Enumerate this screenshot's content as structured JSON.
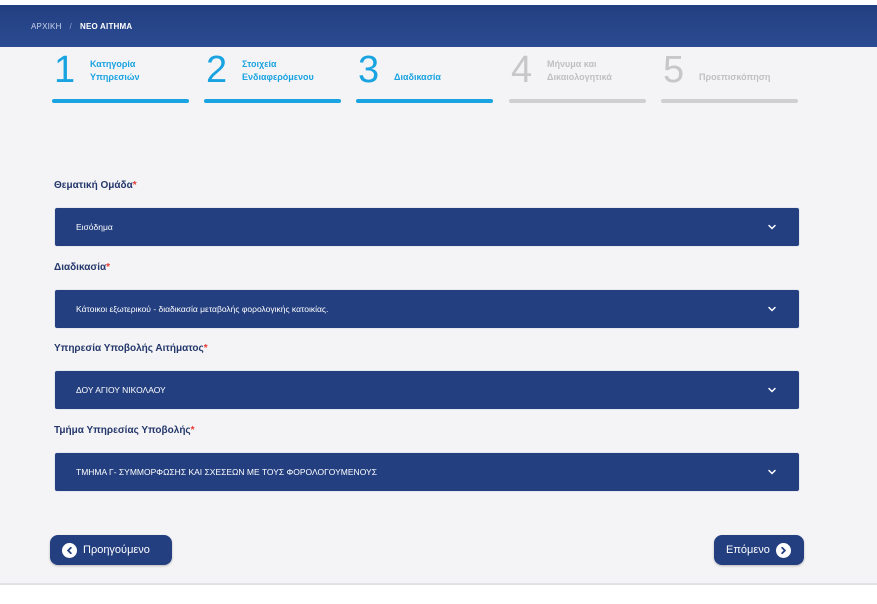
{
  "breadcrumb": {
    "home": "ΑΡΧΙΚΗ",
    "current": "ΝΕΟ ΑΙΤΗΜΑ"
  },
  "steps": [
    {
      "number": "1",
      "line1": "Κατηγορία",
      "line2": "Υπηρεσιών",
      "status": "active"
    },
    {
      "number": "2",
      "line1": "Στοιχεία",
      "line2": "Ενδιαφερόμενου",
      "status": "active"
    },
    {
      "number": "3",
      "line1": "Διαδικασία",
      "line2": "",
      "status": "active"
    },
    {
      "number": "4",
      "line1": "Μήνυμα και",
      "line2": "Δικαιολογητικά",
      "status": "inactive"
    },
    {
      "number": "5",
      "line1": "Προεπισκόπηση",
      "line2": "",
      "status": "inactive"
    }
  ],
  "form": {
    "required_mark": "*",
    "fields": [
      {
        "label": "Θεματική Ομάδα",
        "value": "Εισόδημα"
      },
      {
        "label": "Διαδικασία",
        "value": "Κάτοικοι εξωτερικού - διαδικασία μεταβολής φορολογικής κατοικίας."
      },
      {
        "label": "Υπηρεσία Υποβολής Αιτήματος",
        "value": "ΔΟΥ ΑΓΙΟΥ ΝΙΚΟΛΑΟΥ"
      },
      {
        "label": "Τμήμα Υπηρεσίας Υποβολής",
        "value": "ΤΜΗΜΑ Γ- ΣΥΜΜΟΡΦΩΣΗΣ ΚΑΙ ΣΧΕΣΕΩΝ ΜΕ ΤΟΥΣ ΦΟΡΟΛΟΓΟΥΜΕΝΟΥΣ"
      }
    ]
  },
  "nav": {
    "prev_label": "Προηγούμενο",
    "next_label": "Επόμενο"
  },
  "colors": {
    "primary": "#233f80",
    "accent": "#1aa3e1",
    "inactive": "#cfcfd2",
    "required": "#e53935"
  },
  "icons": {
    "select": "chevron-down-icon",
    "prev": "arrow-left-circle-icon",
    "next": "arrow-right-circle-icon"
  }
}
